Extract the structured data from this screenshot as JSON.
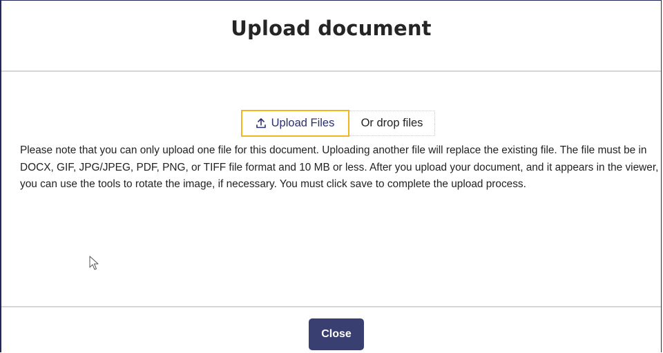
{
  "dialog": {
    "title": "Upload document"
  },
  "upload": {
    "button_label": "Upload Files",
    "button_icon": "upload-icon",
    "drop_label": "Or drop files",
    "accent_color": "#f2b51c"
  },
  "note": {
    "text": "Please note that you can only upload one file for this document. Uploading another file will replace the existing file. The file must be in DOCX, GIF, JPG/JPEG, PDF, PNG, or TIFF file format and 10 MB or less. After you upload your document, and it appears in the viewer, you can use the tools to rotate the image, if necessary. You must click save to complete the upload process."
  },
  "footer": {
    "close_label": "Close",
    "close_color": "#3a3f72"
  }
}
